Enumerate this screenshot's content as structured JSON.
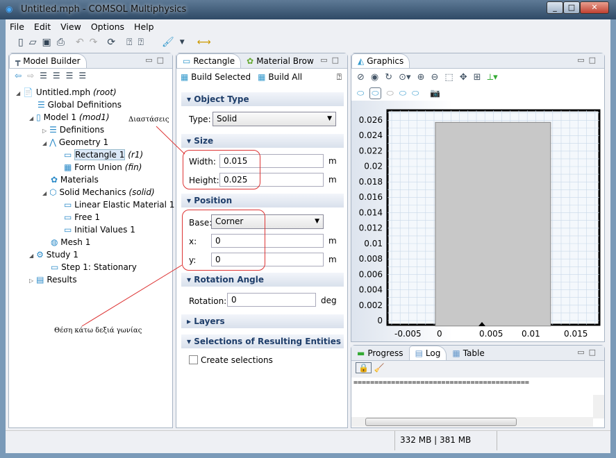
{
  "window": {
    "title": "Untitled.mph - COMSOL Multiphysics",
    "controls": [
      "_",
      "□",
      "✕"
    ]
  },
  "menu": [
    "File",
    "Edit",
    "View",
    "Options",
    "Help"
  ],
  "toolbar_icons": [
    "new-icon",
    "open-icon",
    "save-icon",
    "print-icon",
    "undo-icon",
    "redo-icon",
    "refresh-icon",
    "help-icon",
    "dynamic-help-icon",
    "paint-icon",
    "measure-icon"
  ],
  "model_builder": {
    "tab": "Model Builder",
    "tree": [
      {
        "label": "Untitled.mph",
        "suffix": "(root)",
        "level": 0
      },
      {
        "label": "Global Definitions",
        "suffix": "",
        "level": 1
      },
      {
        "label": "Model 1",
        "suffix": "(mod1)",
        "level": 1
      },
      {
        "label": "Definitions",
        "suffix": "",
        "level": 2
      },
      {
        "label": "Geometry 1",
        "suffix": "",
        "level": 2
      },
      {
        "label": "Rectangle 1",
        "suffix": "(r1)",
        "level": 3,
        "selected": true
      },
      {
        "label": "Form Union",
        "suffix": "(fin)",
        "level": 3
      },
      {
        "label": "Materials",
        "suffix": "",
        "level": 2
      },
      {
        "label": "Solid Mechanics",
        "suffix": "(solid)",
        "level": 2
      },
      {
        "label": "Linear Elastic Material 1",
        "suffix": "",
        "level": 3
      },
      {
        "label": "Free 1",
        "suffix": "",
        "level": 3
      },
      {
        "label": "Initial Values 1",
        "suffix": "",
        "level": 3
      },
      {
        "label": "Mesh 1",
        "suffix": "",
        "level": 2
      },
      {
        "label": "Study 1",
        "suffix": "",
        "level": 1
      },
      {
        "label": "Step 1: Stationary",
        "suffix": "",
        "level": 2
      },
      {
        "label": "Results",
        "suffix": "",
        "level": 1
      }
    ]
  },
  "settings": {
    "tabs": [
      "Rectangle",
      "Material Brow"
    ],
    "build_selected": "Build Selected",
    "build_all": "Build All",
    "object_type": {
      "header": "Object Type",
      "type_label": "Type:",
      "type_value": "Solid"
    },
    "size": {
      "header": "Size",
      "width_label": "Width:",
      "width": "0.015",
      "height_label": "Height:",
      "height": "0.025",
      "unit": "m"
    },
    "position": {
      "header": "Position",
      "base_label": "Base:",
      "base": "Corner",
      "x_label": "x:",
      "x": "0",
      "y_label": "y:",
      "y": "0",
      "unit": "m"
    },
    "rotation": {
      "header": "Rotation Angle",
      "label": "Rotation:",
      "value": "0",
      "unit": "deg"
    },
    "layers": {
      "header": "Layers"
    },
    "selections": {
      "header": "Selections of Resulting Entities",
      "checkbox": "Create selections",
      "checked": false
    }
  },
  "annotations": {
    "size": "Διαστάσεις",
    "position": "Θέση κάτω δεξιά γωνίας",
    "color": "#d33333"
  },
  "graphics": {
    "tab": "Graphics",
    "x_ticks": [
      "-0.005",
      "0",
      "0.005",
      "0.01",
      "0.015",
      "0.0"
    ],
    "y_ticks": [
      "0.026",
      "0.024",
      "0.022",
      "0.02",
      "0.018",
      "0.016",
      "0.014",
      "0.012",
      "0.01",
      "0.008",
      "0.006",
      "0.004",
      "0.002",
      "0"
    ],
    "rect_fill": "#c8c8c8"
  },
  "log": {
    "tabs": [
      "Progress",
      "Log",
      "Table"
    ],
    "content": "=========================================="
  },
  "status": {
    "memory": "332 MB | 381 MB"
  }
}
